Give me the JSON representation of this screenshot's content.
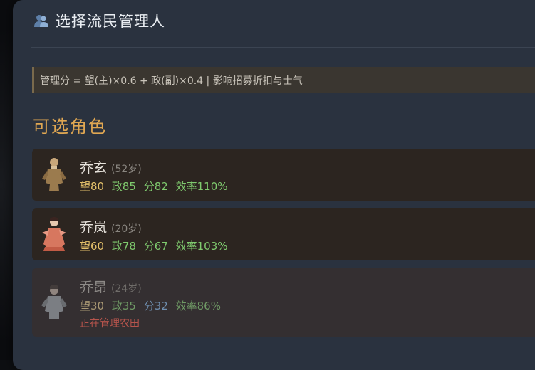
{
  "dialog": {
    "title": "选择流民管理人",
    "formula": "管理分 = 望(主)×0.6 + 政(副)×0.4 | 影响招募折扣与士气",
    "section_title": "可选角色"
  },
  "candidates": [
    {
      "name": "乔玄",
      "age": "(52岁)",
      "wang": "望80",
      "zheng": "政85",
      "fen": "分82",
      "eff": "效率110%",
      "status": "",
      "available": true
    },
    {
      "name": "乔岚",
      "age": "(20岁)",
      "wang": "望60",
      "zheng": "政78",
      "fen": "分67",
      "eff": "效率103%",
      "status": "",
      "available": true
    },
    {
      "name": "乔昂",
      "age": "(24岁)",
      "wang": "望30",
      "zheng": "政35",
      "fen": "分32",
      "eff": "效率86%",
      "status": "正在管理农田",
      "available": false
    }
  ],
  "icons": {
    "header": "people-icon",
    "portraits": [
      "elder-official-portrait",
      "young-woman-portrait",
      "young-man-portrait"
    ]
  },
  "colors": {
    "panel": "#2a323f",
    "accent": "#e0a752",
    "stat_gold": "#e3c06a",
    "stat_green": "#7fca6e",
    "status_red": "#b6544c"
  }
}
